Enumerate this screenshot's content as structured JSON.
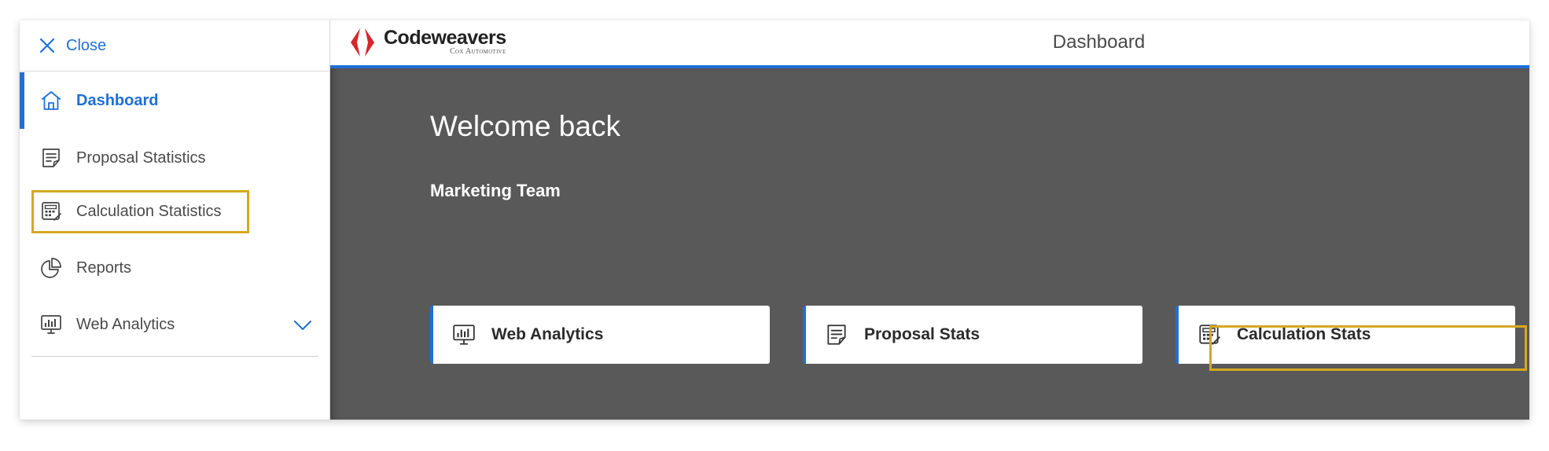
{
  "sidebar": {
    "close_label": "Close",
    "items": [
      {
        "label": "Dashboard",
        "icon": "home-icon"
      },
      {
        "label": "Proposal Statistics",
        "icon": "document-icon"
      },
      {
        "label": "Calculation Statistics",
        "icon": "calculator-icon"
      },
      {
        "label": "Reports",
        "icon": "pie-chart-icon"
      },
      {
        "label": "Web Analytics",
        "icon": "analytics-monitor-icon"
      }
    ],
    "active_index": 0,
    "highlighted_item": "Calculation Statistics"
  },
  "header": {
    "logo_name": "Codeweavers",
    "logo_sub": "Cox Automotive",
    "title": "Dashboard"
  },
  "main": {
    "welcome": "Welcome back",
    "team": "Marketing Team",
    "cards": [
      {
        "label": "Web Analytics",
        "icon": "analytics-monitor-icon"
      },
      {
        "label": "Proposal Stats",
        "icon": "document-icon"
      },
      {
        "label": "Calculation Stats",
        "icon": "calculator-icon"
      }
    ],
    "highlighted_card": "Calculation Stats"
  },
  "colors": {
    "accent": "#1f6fd6",
    "highlight": "#d4a820",
    "main_bg": "#595959",
    "logo_red": "#d7262b"
  }
}
